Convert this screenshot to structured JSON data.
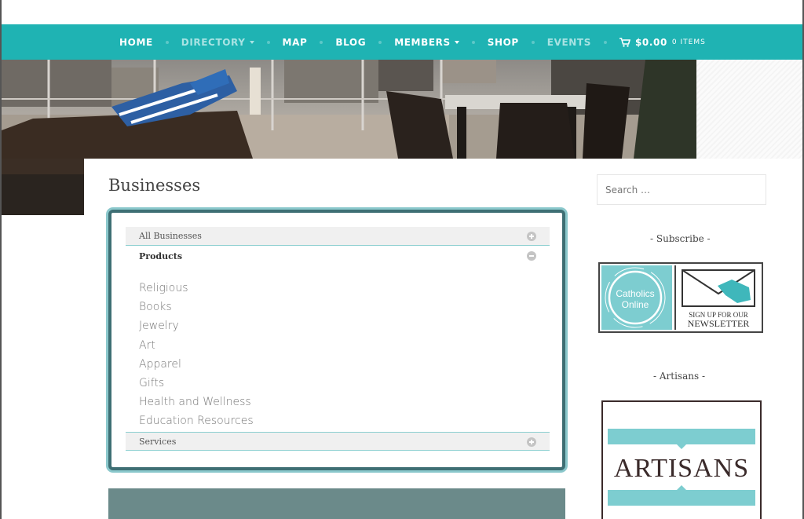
{
  "nav": {
    "items": [
      {
        "label": "HOME",
        "dim": false,
        "caret": false
      },
      {
        "label": "DIRECTORY",
        "dim": true,
        "caret": true
      },
      {
        "label": "MAP",
        "dim": false,
        "caret": false
      },
      {
        "label": "BLOG",
        "dim": false,
        "caret": false
      },
      {
        "label": "MEMBERS",
        "dim": false,
        "caret": true
      },
      {
        "label": "SHOP",
        "dim": false,
        "caret": false
      },
      {
        "label": "EVENTS",
        "dim": true,
        "caret": false
      }
    ],
    "cart_total": "$0.00",
    "cart_items": "0 ITEMS",
    "accent_color": "#1fb3b3"
  },
  "page": {
    "title": "Businesses"
  },
  "directory": {
    "all_label": "All Businesses",
    "products_label": "Products",
    "services_label": "Services",
    "products": [
      "Religious",
      "Books",
      "Jewelry",
      "Art",
      "Apparel",
      "Gifts",
      "Health and Wellness",
      "Education Resources"
    ],
    "border_color": "#3e6f74"
  },
  "sidebar": {
    "search_placeholder": "Search …",
    "subscribe_title": "- Subscribe -",
    "newsletter": {
      "logo_line1": "Catholics",
      "logo_line2": "Online",
      "signup_line": "SIGN UP FOR OUR",
      "newsletter_word": "NEWSLETTER"
    },
    "artisans_title": "- Artisans -",
    "artisans_word": "ARTISANS"
  }
}
